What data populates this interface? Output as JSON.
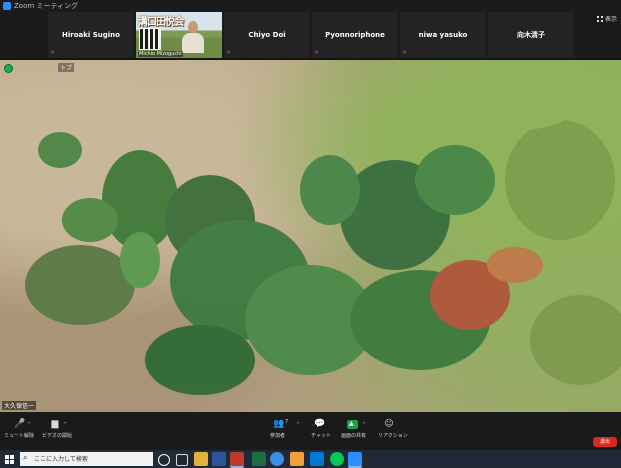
{
  "window": {
    "title": "Zoom ミーティング"
  },
  "participants": [
    {
      "name": "Hiroaki Sugino",
      "muted": true
    },
    {
      "name": "Chiyo Doi",
      "muted": true
    },
    {
      "name": "Pyonnoriphone",
      "muted": true
    },
    {
      "name": "niwa yasuko",
      "muted": true
    },
    {
      "name": "向木清子",
      "muted": false
    }
  ],
  "video_tile": {
    "banner": "溝口田悦会",
    "name": "Michio Mizoguchi"
  },
  "view_button": {
    "label": "表示"
  },
  "main_video": {
    "speaker": "大久保信一",
    "info": "トブ"
  },
  "controls": {
    "mute": "ミュート解除",
    "video": "ビデオの開始",
    "participants": "参加者",
    "participants_count": "7",
    "chat": "チャット",
    "share": "画面の共有",
    "reactions": "リアクション",
    "end": "退出"
  },
  "taskbar": {
    "search_placeholder": "ここに入力して検索"
  }
}
